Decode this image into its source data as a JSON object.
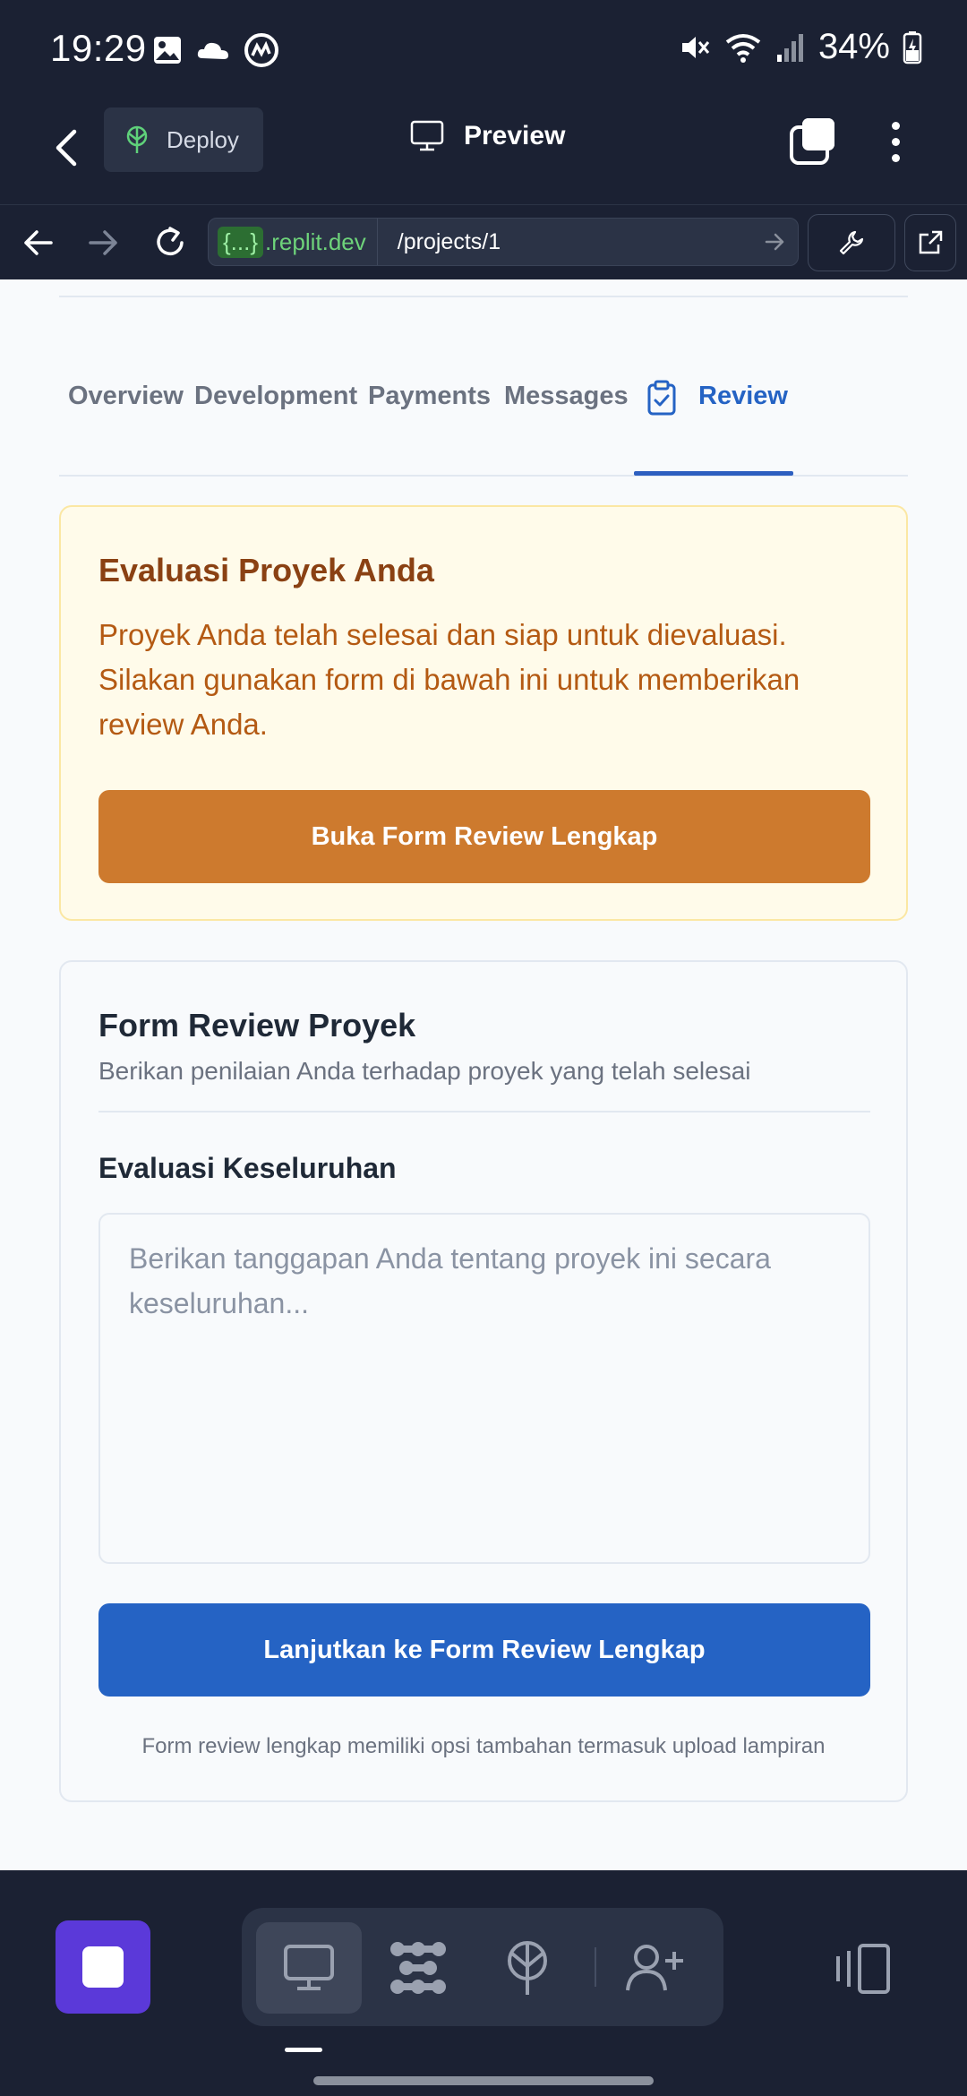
{
  "status_bar": {
    "time": "19:29",
    "battery": "34%"
  },
  "app_header": {
    "deploy_label": "Deploy",
    "title": "Preview"
  },
  "url_bar": {
    "domain_brace": "{...}",
    "domain": ".replit.dev",
    "path": "/projects/1"
  },
  "tabs": [
    {
      "label": "Overview"
    },
    {
      "label": "Development"
    },
    {
      "label": "Payments"
    },
    {
      "label": "Messages"
    },
    {
      "label": "Review"
    }
  ],
  "active_tab": "Review",
  "alert": {
    "title": "Evaluasi Proyek Anda",
    "text": "Proyek Anda telah selesai dan siap untuk dievaluasi. Silakan gunakan form di bawah ini untuk memberikan review Anda.",
    "button_label": "Buka Form Review Lengkap"
  },
  "form": {
    "title": "Form Review Proyek",
    "subtitle": "Berikan penilaian Anda terhadap proyek yang telah selesai",
    "field_label": "Evaluasi Keseluruhan",
    "textarea_value": "",
    "textarea_placeholder": "Berikan tanggapan Anda tentang proyek ini secara keseluruhan...",
    "submit_label": "Lanjutkan ke Form Review Lengkap",
    "note": "Form review lengkap memiliki opsi tambahan termasuk upload lampiran"
  },
  "colors": {
    "accent_blue": "#2563c4",
    "accent_orange": "#cd7a2e",
    "alert_bg": "#fffbea",
    "stop_button": "#5b39d9",
    "chrome_bg": "#1b2133"
  },
  "icons": {
    "status_left": [
      "gallery-icon",
      "cloud-icon",
      "coinmarketcap-icon"
    ],
    "status_right": [
      "mute-icon",
      "wifi-icon",
      "signal-icon",
      "battery-icon"
    ],
    "dock": [
      "desktop-icon",
      "workspace-icon",
      "deploy-icon",
      "invite-user-icon"
    ]
  }
}
